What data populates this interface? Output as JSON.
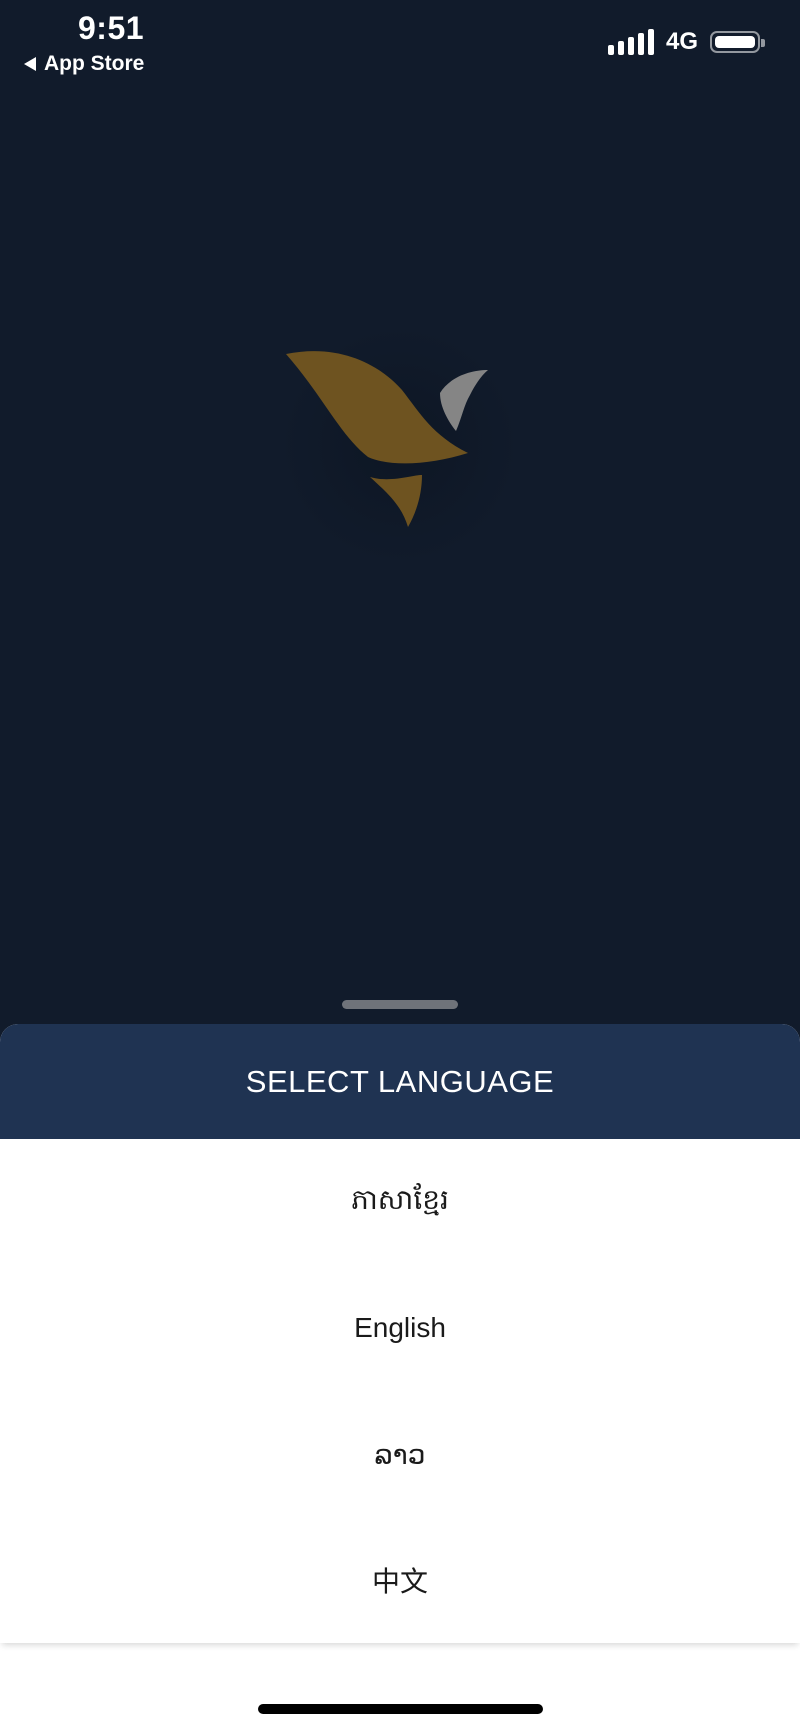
{
  "status_bar": {
    "time": "9:51",
    "back_label": "App Store",
    "network": "4G",
    "signal_icon": "signal-bars-icon",
    "battery_icon": "battery-full-icon"
  },
  "logo": {
    "icon": "bird-logo-icon",
    "colors": {
      "gold": "#6e5320",
      "gray": "#858585"
    }
  },
  "language_sheet": {
    "title": "SELECT LANGUAGE",
    "languages": [
      {
        "label": "ភាសាខ្មែរ"
      },
      {
        "label": "English"
      },
      {
        "label": "ລາວ"
      },
      {
        "label": "中文"
      }
    ]
  },
  "colors": {
    "background": "#111b2b",
    "sheet_header": "#1f3352",
    "sheet_body": "#ffffff"
  }
}
